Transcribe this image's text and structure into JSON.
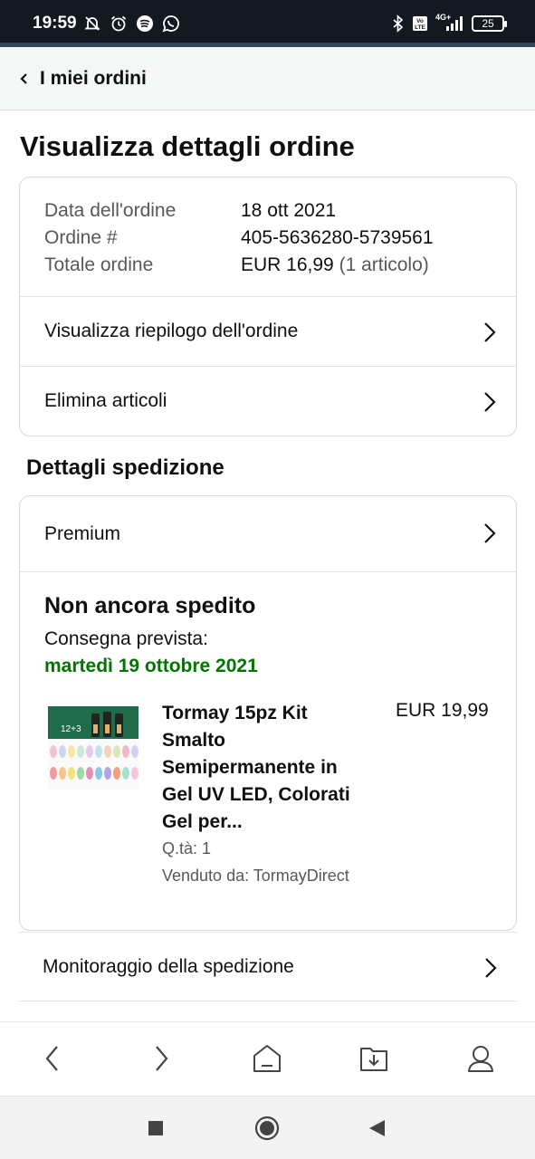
{
  "status_bar": {
    "time": "19:59",
    "battery": "25",
    "network": "4G+",
    "left_icons": [
      "muted-bell-icon",
      "alarm-icon",
      "spotify-icon",
      "whatsapp-icon"
    ],
    "right_icons": [
      "bluetooth-icon",
      "volte-icon",
      "signal-icon",
      "battery-icon"
    ]
  },
  "header": {
    "back_label": "I miei ordini"
  },
  "page": {
    "title": "Visualizza dettagli ordine"
  },
  "order_info": {
    "rows": [
      {
        "label": "Data dell'ordine",
        "value": "18 ott 2021"
      },
      {
        "label": "Ordine #",
        "value": "405-5636280-5739561"
      },
      {
        "label": "Totale ordine",
        "value": "EUR 16,99",
        "extra": "(1 articolo)"
      }
    ],
    "links": [
      {
        "label": "Visualizza riepilogo dell'ordine"
      },
      {
        "label": "Elimina articoli"
      }
    ]
  },
  "shipping": {
    "section_title": "Dettagli spedizione",
    "method": "Premium",
    "status": "Non ancora spedito",
    "delivery_label": "Consegna prevista:",
    "delivery_date": "martedì 19 ottobre 2021",
    "product": {
      "title": "Tormay 15pz Kit Smalto Semipermanente in Gel UV LED, Colorati Gel per...",
      "price": "EUR 19,99",
      "qty": "Q.tà: 1",
      "seller": "Venduto da: TormayDirect",
      "image_text": "12+3"
    },
    "tracking_label": "Monitoraggio della spedizione"
  },
  "browser_toolbar": [
    "back-arrow-icon",
    "forward-arrow-icon",
    "home-icon",
    "downloads-icon",
    "profile-icon"
  ],
  "android_nav": [
    "recents-square-icon",
    "home-circle-icon",
    "back-triangle-icon"
  ],
  "colors": {
    "statusbar_bg": "#131921",
    "delivery_green": "#007600",
    "muted_text": "#565959"
  }
}
